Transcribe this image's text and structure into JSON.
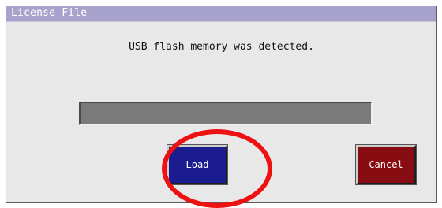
{
  "dialog": {
    "title": "License File",
    "message": "USB flash memory was detected.",
    "progress": 0
  },
  "buttons": {
    "load_label": "Load",
    "cancel_label": "Cancel"
  },
  "colors": {
    "titlebar": "#a7a3cc",
    "load_button": "#1b1c8f",
    "cancel_button": "#880d12",
    "annotation": "#ee1111"
  }
}
